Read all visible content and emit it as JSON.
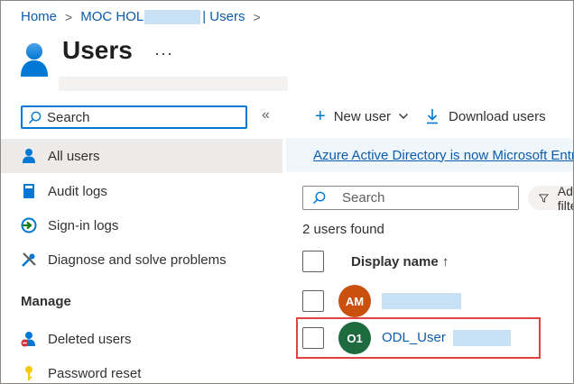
{
  "breadcrumb": {
    "home": "Home",
    "tenant": "MOC HOL",
    "section": "| Users",
    "separator": ">"
  },
  "page": {
    "title": "Users",
    "more_label": "···"
  },
  "nav": {
    "search_placeholder": "Search",
    "collapse_label": "«",
    "items": [
      {
        "label": "All users",
        "icon": "user-icon",
        "active": true
      },
      {
        "label": "Audit logs",
        "icon": "book-icon"
      },
      {
        "label": "Sign-in logs",
        "icon": "sign-in-icon"
      },
      {
        "label": "Diagnose and solve problems",
        "icon": "wrench-icon"
      }
    ],
    "section_manage": "Manage",
    "manage_items": [
      {
        "label": "Deleted users",
        "icon": "deleted-user-icon"
      },
      {
        "label": "Password reset",
        "icon": "key-icon"
      }
    ]
  },
  "toolbar": {
    "new_user": "New user",
    "download_users": "Download users"
  },
  "banner": {
    "text": "Azure Active Directory is now Microsoft Entra ID"
  },
  "list": {
    "search_placeholder": "Search",
    "filter_label": "Add filter",
    "count": "2 users found",
    "column_display_name": "Display name ↑",
    "rows": [
      {
        "initials": "AM",
        "name": "",
        "avatar_color": "#ca5010"
      },
      {
        "initials": "O1",
        "name": "ODL_User",
        "avatar_color": "#1e6b3f"
      }
    ]
  },
  "colors": {
    "accent": "#0078d4",
    "link": "#0b5cad",
    "highlight": "#e04343"
  }
}
